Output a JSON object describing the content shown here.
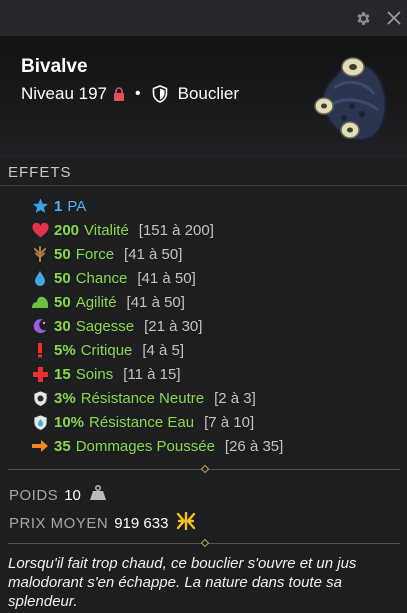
{
  "item": {
    "name": "Bivalve",
    "level_text": "Niveau 197",
    "type": "Bouclier"
  },
  "effects_title": "EFFETS",
  "effects": [
    {
      "icon": "star-icon",
      "value": "1",
      "label": "PA",
      "range": ""
    },
    {
      "icon": "heart-icon",
      "value": "200",
      "label": "Vitalité",
      "range": "[151 à 200]"
    },
    {
      "icon": "strength-icon",
      "value": "50",
      "label": "Force",
      "range": "[41 à 50]"
    },
    {
      "icon": "water-drop-icon",
      "value": "50",
      "label": "Chance",
      "range": "[41 à 50]"
    },
    {
      "icon": "agility-icon",
      "value": "50",
      "label": "Agilité",
      "range": "[41 à 50]"
    },
    {
      "icon": "wisdom-icon",
      "value": "30",
      "label": "Sagesse",
      "range": "[21 à 30]"
    },
    {
      "icon": "critical-icon",
      "value": "5%",
      "label": "Critique",
      "range": "[4 à 5]"
    },
    {
      "icon": "heal-cross-icon",
      "value": "15",
      "label": "Soins",
      "range": "[11 à 15]"
    },
    {
      "icon": "neutral-resistance-icon",
      "value": "3%",
      "label": "Résistance Neutre",
      "range": "[2 à 3]"
    },
    {
      "icon": "water-resistance-icon",
      "value": "10%",
      "label": "Résistance Eau",
      "range": "[7 à 10]"
    },
    {
      "icon": "push-damage-icon",
      "value": "35",
      "label": "Dommages Poussée",
      "range": "[26 à 35]"
    }
  ],
  "weight": {
    "label": "POIDS",
    "value": "10"
  },
  "price": {
    "label": "PRIX MOYEN",
    "value": "919 633"
  },
  "description": "Lorsqu'il fait trop chaud, ce bouclier s'ouvre et un jus malodorant s'en échappe. La nature dans toute sa splendeur."
}
